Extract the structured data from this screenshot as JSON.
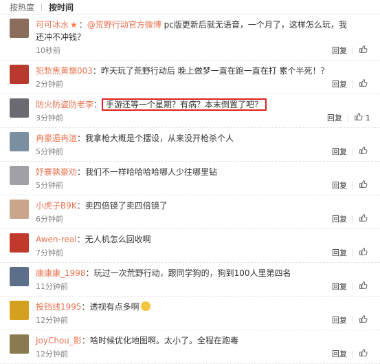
{
  "sort": {
    "hot": "按热度",
    "time": "按时间"
  },
  "actions": {
    "reply": "回复"
  },
  "comments": [
    {
      "user": "可可冰水",
      "vip": "★",
      "sep": "：",
      "mention": "@荒野行动官方微博",
      "text": " pc版更新后就无语音，一个月了，这样怎么玩，我还冲不冲钱？",
      "time": "10秒前",
      "likes": "",
      "avatar_color": "#8a6d5a"
    },
    {
      "user": "犯愁焦黄懔003",
      "sep": "：",
      "text": "昨天玩了荒野行动后 晚上做梦一直在跑一直在打 累个半死！？",
      "time": "2分钟前",
      "likes": "",
      "avatar_color": "#b83a2e"
    },
    {
      "user": "防火防盗防老李",
      "sep": "：",
      "text": "手游还等一个星期？有病？本末倒置了吧？",
      "time": "3分钟前",
      "likes": "1",
      "avatar_color": "#6a6a70"
    },
    {
      "user": "冉豪遁冉渲",
      "sep": "：",
      "text": "我拿枪大概是个摆设，从来没开枪杀个人",
      "time": "5分钟前",
      "likes": "",
      "avatar_color": "#7a8fa0"
    },
    {
      "user": "妤褰孰豪劝",
      "sep": "：",
      "text": "我们不一样哈哈哈哈哪人少往哪里钻",
      "time": "5分钟前",
      "likes": "",
      "avatar_color": "#a0a0a6"
    },
    {
      "user": "小虎子B9K",
      "sep": "：",
      "text": "卖四倍镜了卖四倍镜了",
      "time": "6分钟前",
      "likes": "",
      "avatar_color": "#c9a58c"
    },
    {
      "user": "Awen-real",
      "sep": "：",
      "text": "无人机怎么回收啊",
      "time": "7分钟前",
      "likes": "",
      "avatar_color": "#c0392b"
    },
    {
      "user": "康康康_1998",
      "sep": "：",
      "text": "玩过一次荒野行动，跟同学狗的，狗到100人里第四名",
      "time": "11分钟前",
      "likes": "",
      "avatar_color": "#5b6e8a"
    },
    {
      "user": "投铛线1995",
      "sep": "：",
      "text": "透视有点多啊",
      "emoji": true,
      "time": "12分钟前",
      "likes": "",
      "avatar_color": "#d4a020"
    },
    {
      "user": "JoyChou_影",
      "sep": "：",
      "text": "啥时候优化地图啊。太小了。全程在跑毒",
      "time": "12分钟前",
      "likes": "",
      "avatar_color": "#8a7a50"
    }
  ]
}
